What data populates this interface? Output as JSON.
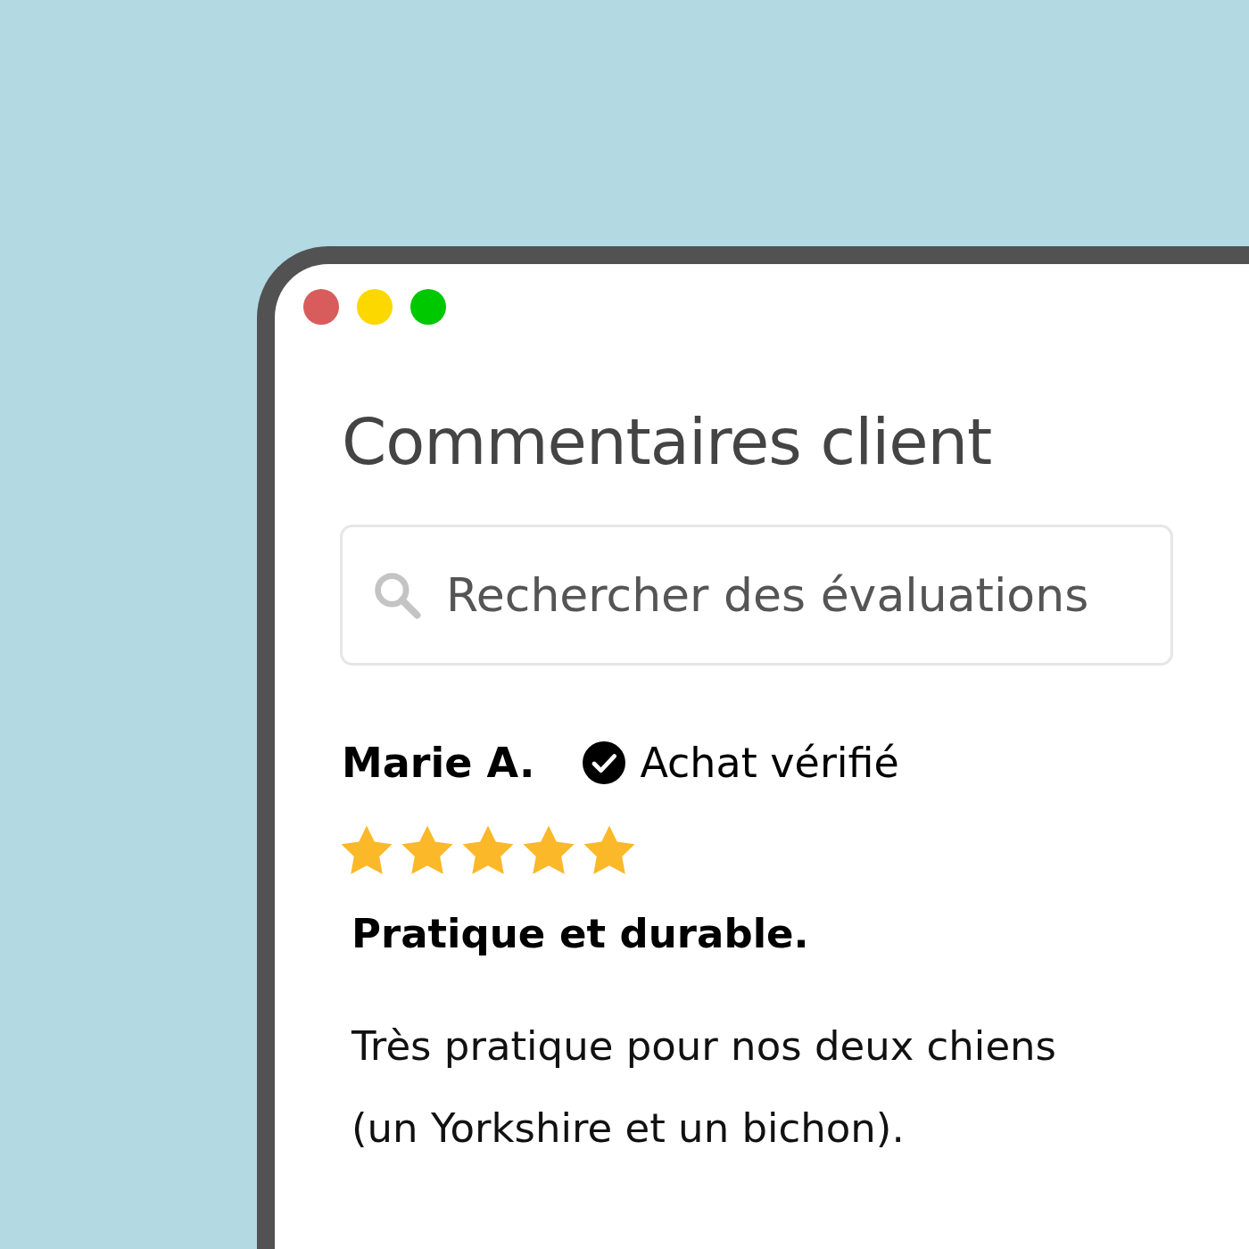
{
  "window": {
    "title": "Commentaires client"
  },
  "search": {
    "placeholder": "Rechercher des évaluations"
  },
  "review": {
    "author": "Marie A.",
    "verified": true,
    "verified_label": "Achat vérifié",
    "stars": 5,
    "title": "Pratique et durable.",
    "body": "Très pratique pour nos deux chiens (un Yorkshire et un bichon)."
  }
}
